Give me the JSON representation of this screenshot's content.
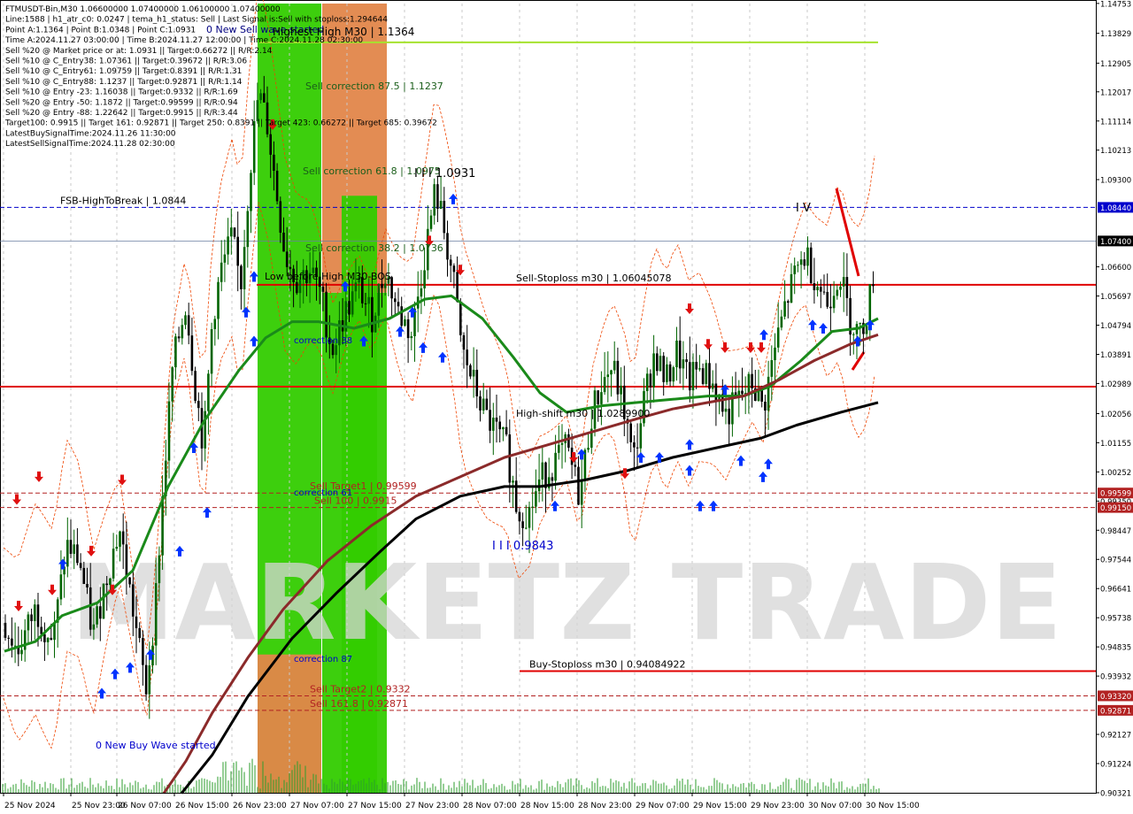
{
  "header": {
    "lines": [
      "FTMUSDT-Bin,M30   1.06600000 1.07400000 1.06100000 1.07400000",
      "Line:1588 | h1_atr_c0: 0.0247 | tema_h1_status: Sell | Last Signal is:Sell with stoploss:1.294644",
      "Point A:1.1364 | Point B:1.0348 | Point C:1.0931",
      "Time A:2024.11.27 03:00:00 | Time B:2024.11.27 12:00:00 | Time C:2024.11.28 02:30:00",
      "Sell %20 @ Market price or at: 1.0931 || Target:0.66272 || R/R:2.14",
      "Sell %10 @ C_Entry38: 1.07361 || Target:0.39672 || R/R:3.06",
      "Sell %10 @ C_Entry61: 1.09759 || Target:0.8391 || R/R:1.31",
      "Sell %10 @ C_Entry88: 1.1237 || Target:0.92871 || R/R:1.14",
      "Sell %10 @ Entry -23: 1.16038 || Target:0.9332 || R/R:1.69",
      "Sell %20 @ Entry -50: 1.1872 || Target:0.99599 || R/R:0.94",
      "Sell %20 @ Entry -88: 1.22642 || Target:0.9915 || R/R:3.44",
      "Target100: 0.9915 || Target 161: 0.92871 || Target 250: 0.8391 || Target 423: 0.66272 || Target 685: 0.39672",
      "LatestBuySignalTime:2024.11.26 11:30:00",
      "LatestSellSignalTime:2024.11.28 02:30:00"
    ]
  },
  "watermark": "MARKETZ TRADE",
  "colors": {
    "background": "#ffffff",
    "bull_candle": "#006400",
    "bear_candle": "#000000",
    "ma_green": "#1a8a1a",
    "ma_brown": "#8b2a2a",
    "ma_black": "#000000",
    "red_level": "#e00000",
    "blue_level": "#0000cc",
    "green_zone": "#33cc00",
    "orange_zone": "#e2864a",
    "lime_line": "#a6e22e",
    "buy_arrow": "#0033ff",
    "sell_arrow": "#e01010",
    "orange_band": "#ee4400"
  },
  "chart_data": {
    "type": "candlestick",
    "symbol": "FTMUSDT-Bin",
    "timeframe": "M30",
    "ylim": [
      0.9032,
      1.1475
    ],
    "y_ticks": [
      "1.14753",
      "1.13829",
      "1.12905",
      "1.12017",
      "1.11114",
      "1.10213",
      "1.09300",
      "1.08440",
      "1.07400",
      "1.06600",
      "1.05697",
      "1.04794",
      "1.03891",
      "1.02989",
      "1.02056",
      "1.01155",
      "1.00252",
      "0.99599",
      "0.99350",
      "0.99150",
      "0.98447",
      "0.97544",
      "0.96641",
      "0.95738",
      "0.94835",
      "0.93932",
      "0.93320",
      "0.92871",
      "0.92127",
      "0.91224",
      "0.90321"
    ],
    "highlighted_ticks": [
      {
        "label": "1.08440",
        "color": "#0000cc"
      },
      {
        "label": "1.07400",
        "color": "#000000"
      },
      {
        "label": "0.99599",
        "color": "#b22222"
      },
      {
        "label": "0.99150",
        "color": "#b22222"
      },
      {
        "label": "0.93320",
        "color": "#b22222"
      },
      {
        "label": "0.92871",
        "color": "#b22222"
      }
    ],
    "x_labels": [
      "25 Nov 2024",
      "25 Nov 23:00",
      "26 Nov 07:00",
      "26 Nov 15:00",
      "26 Nov 23:00",
      "27 Nov 07:00",
      "27 Nov 15:00",
      "27 Nov 23:00",
      "28 Nov 07:00",
      "28 Nov 15:00",
      "28 Nov 23:00",
      "29 Nov 07:00",
      "29 Nov 15:00",
      "29 Nov 23:00",
      "30 Nov 07:00",
      "30 Nov 15:00"
    ],
    "close_path": [
      [
        0,
        0.958
      ],
      [
        20,
        0.947
      ],
      [
        40,
        0.96
      ],
      [
        60,
        0.95
      ],
      [
        75,
        0.98
      ],
      [
        90,
        0.975
      ],
      [
        105,
        0.952
      ],
      [
        120,
        0.97
      ],
      [
        135,
        0.985
      ],
      [
        150,
        0.96
      ],
      [
        165,
        0.935
      ],
      [
        175,
        0.96
      ],
      [
        185,
        1.0
      ],
      [
        195,
        1.035
      ],
      [
        210,
        1.055
      ],
      [
        220,
        1.03
      ],
      [
        230,
        1.01
      ],
      [
        240,
        1.05
      ],
      [
        250,
        1.065
      ],
      [
        262,
        1.075
      ],
      [
        272,
        1.06
      ],
      [
        282,
        1.095
      ],
      [
        292,
        1.12
      ],
      [
        302,
        1.11
      ],
      [
        312,
        1.09
      ],
      [
        322,
        1.07
      ],
      [
        335,
        1.062
      ],
      [
        350,
        1.065
      ],
      [
        362,
        1.058
      ],
      [
        375,
        1.04
      ],
      [
        390,
        1.052
      ],
      [
        405,
        1.06
      ],
      [
        420,
        1.05
      ],
      [
        435,
        1.065
      ],
      [
        450,
        1.052
      ],
      [
        465,
        1.045
      ],
      [
        480,
        1.07
      ],
      [
        492,
        1.09
      ],
      [
        500,
        1.08
      ],
      [
        512,
        1.062
      ],
      [
        522,
        1.04
      ],
      [
        535,
        1.03
      ],
      [
        548,
        1.02
      ],
      [
        560,
        1.015
      ],
      [
        572,
        1.01
      ],
      [
        585,
        0.99
      ],
      [
        598,
        0.99
      ],
      [
        610,
        1.0
      ],
      [
        625,
        1.005
      ],
      [
        640,
        1.01
      ],
      [
        655,
        0.995
      ],
      [
        668,
        1.02
      ],
      [
        680,
        1.03
      ],
      [
        692,
        1.035
      ],
      [
        705,
        1.022
      ],
      [
        715,
        1.005
      ],
      [
        728,
        1.025
      ],
      [
        740,
        1.04
      ],
      [
        752,
        1.03
      ],
      [
        765,
        1.04
      ],
      [
        778,
        1.03
      ],
      [
        790,
        1.035
      ],
      [
        805,
        1.03
      ],
      [
        820,
        1.02
      ],
      [
        835,
        1.025
      ],
      [
        850,
        1.03
      ],
      [
        862,
        1.022
      ],
      [
        875,
        1.04
      ],
      [
        888,
        1.055
      ],
      [
        900,
        1.065
      ],
      [
        910,
        1.07
      ],
      [
        922,
        1.062
      ],
      [
        935,
        1.055
      ],
      [
        948,
        1.065
      ],
      [
        960,
        1.05
      ],
      [
        972,
        1.045
      ],
      [
        982,
        1.055
      ],
      [
        992,
        1.074
      ]
    ],
    "moving_averages": [
      {
        "color": "#1a8a1a",
        "points": [
          [
            5,
            0.947
          ],
          [
            40,
            0.95
          ],
          [
            70,
            0.958
          ],
          [
            110,
            0.962
          ],
          [
            150,
            0.972
          ],
          [
            190,
            0.998
          ],
          [
            230,
            1.018
          ],
          [
            270,
            1.034
          ],
          [
            300,
            1.044
          ],
          [
            330,
            1.049
          ],
          [
            360,
            1.049
          ],
          [
            400,
            1.047
          ],
          [
            440,
            1.05
          ],
          [
            480,
            1.056
          ],
          [
            510,
            1.057
          ],
          [
            545,
            1.05
          ],
          [
            580,
            1.038
          ],
          [
            610,
            1.027
          ],
          [
            640,
            1.021
          ],
          [
            680,
            1.023
          ],
          [
            720,
            1.024
          ],
          [
            760,
            1.025
          ],
          [
            800,
            1.026
          ],
          [
            840,
            1.026
          ],
          [
            870,
            1.029
          ],
          [
            905,
            1.037
          ],
          [
            940,
            1.046
          ],
          [
            970,
            1.047
          ],
          [
            992,
            1.05
          ]
        ]
      },
      {
        "color": "#8b2a2a",
        "points": [
          [
            185,
            0.903
          ],
          [
            210,
            0.913
          ],
          [
            240,
            0.928
          ],
          [
            280,
            0.945
          ],
          [
            320,
            0.96
          ],
          [
            370,
            0.975
          ],
          [
            420,
            0.986
          ],
          [
            470,
            0.995
          ],
          [
            520,
            1.001
          ],
          [
            570,
            1.007
          ],
          [
            620,
            1.011
          ],
          [
            670,
            1.015
          ],
          [
            720,
            1.019
          ],
          [
            760,
            1.022
          ],
          [
            800,
            1.024
          ],
          [
            840,
            1.026
          ],
          [
            880,
            1.031
          ],
          [
            920,
            1.037
          ],
          [
            960,
            1.042
          ],
          [
            992,
            1.045
          ]
        ]
      },
      {
        "color": "#000000",
        "points": [
          [
            205,
            0.903
          ],
          [
            240,
            0.915
          ],
          [
            280,
            0.933
          ],
          [
            330,
            0.951
          ],
          [
            380,
            0.965
          ],
          [
            430,
            0.978
          ],
          [
            470,
            0.988
          ],
          [
            520,
            0.995
          ],
          [
            570,
            0.998
          ],
          [
            610,
            0.998
          ],
          [
            660,
            1.0
          ],
          [
            710,
            1.003
          ],
          [
            760,
            1.007
          ],
          [
            810,
            1.01
          ],
          [
            860,
            1.013
          ],
          [
            900,
            1.017
          ],
          [
            950,
            1.021
          ],
          [
            992,
            1.024
          ]
        ]
      }
    ],
    "levels": [
      {
        "name": "fsb-high-to-break",
        "value": 1.0844,
        "style": "dashed",
        "color": "#0000cc",
        "label": "FSB-HighToBreak | 1.0844"
      },
      {
        "name": "current-price",
        "value": 1.074,
        "style": "thin",
        "color": "#6b7fa0",
        "label": ""
      },
      {
        "name": "sell-stoploss",
        "value": 1.06045,
        "style": "solid",
        "color": "#e00000",
        "label": "Sell-Stoploss m30 | 1.06045078"
      },
      {
        "name": "high-shift",
        "value": 1.0289,
        "style": "solid",
        "color": "#e00000",
        "label": ""
      },
      {
        "name": "sell-target1",
        "value": 0.99599,
        "style": "dashed",
        "color": "#b22222",
        "label": "Sell Target1 | 0.99599"
      },
      {
        "name": "sell-100",
        "value": 0.9915,
        "style": "dashed",
        "color": "#b22222",
        "label": "Sell 100 | 0.9915"
      },
      {
        "name": "buy-stoploss",
        "value": 0.94085,
        "style": "solid",
        "color": "#e00000",
        "label": "Buy-Stoploss m30 | 0.94084922"
      },
      {
        "name": "sell-target2",
        "value": 0.9332,
        "style": "dashed",
        "color": "#b22222",
        "label": "Sell Target2 | 0.9332"
      },
      {
        "name": "sell-161",
        "value": 0.92871,
        "style": "dashed",
        "color": "#b22222",
        "label": "Sell 161.8 | 0.92871"
      }
    ],
    "annotations": [
      {
        "text": "0 New Sell wave started",
        "color": "#000080"
      },
      {
        "text": "Highest High   M30 | 1.1364",
        "color": "#000000"
      },
      {
        "text": "Sell correction 87.5 | 1.1237",
        "color": "#1a5e1a"
      },
      {
        "text": "Sell correction 61.8 | 1.0975",
        "color": "#1a5e1a"
      },
      {
        "text": "I I I 1.0931",
        "color": "#000000"
      },
      {
        "text": "Sell correction 38.2 | 1.0736",
        "color": "#1a5e1a"
      },
      {
        "text": "Low before High   M30-BOS",
        "color": "#000000"
      },
      {
        "text": "correction 38",
        "color": "#0000cc"
      },
      {
        "text": "High-shift  m30 | 1.0289900",
        "color": "#000000"
      },
      {
        "text": "correction 61",
        "color": "#0000cc"
      },
      {
        "text": "I I I 0.9843",
        "color": "#0000cc"
      },
      {
        "text": "correction 87",
        "color": "#0000cc"
      },
      {
        "text": "0 New Buy Wave started",
        "color": "#0000cc"
      },
      {
        "text": "I V",
        "color": "#000000"
      }
    ],
    "zones": [
      {
        "name": "green-zone-1",
        "color": "#33cc00",
        "from": 1.1475,
        "to": 0.9032
      },
      {
        "name": "orange-zone-1",
        "color": "#e2864a",
        "from": 0.946,
        "to": 0.9032
      },
      {
        "name": "green-zone-2",
        "color": "#33cc00",
        "from": 1.058,
        "to": 0.9032
      },
      {
        "name": "orange-zone-2",
        "color": "#e2864a",
        "from": 1.1475,
        "to": 1.058
      },
      {
        "name": "green-zone-3",
        "color": "#33cc00",
        "from": 1.088,
        "to": 0.9032
      }
    ],
    "buy_signals": [
      1.043,
      1.052,
      0.99,
      0.978,
      0.946,
      0.942,
      0.94,
      0.934,
      0.974,
      1.01,
      1.063,
      1.06,
      1.043,
      1.046,
      1.052,
      1.041,
      1.038,
      1.087,
      0.992,
      1.008,
      1.006,
      1.045,
      0.992,
      0.992,
      1.007,
      1.007,
      1.003,
      1.011,
      1.028,
      1.001,
      1.005,
      1.048,
      1.047,
      1.043,
      1.048
    ],
    "sell_signals": [
      0.994,
      0.966,
      0.966,
      0.961,
      1.001,
      1.0,
      0.978,
      1.11,
      1.074,
      1.065,
      1.007,
      1.002,
      1.053,
      1.042,
      1.041,
      1.041,
      1.041
    ]
  }
}
